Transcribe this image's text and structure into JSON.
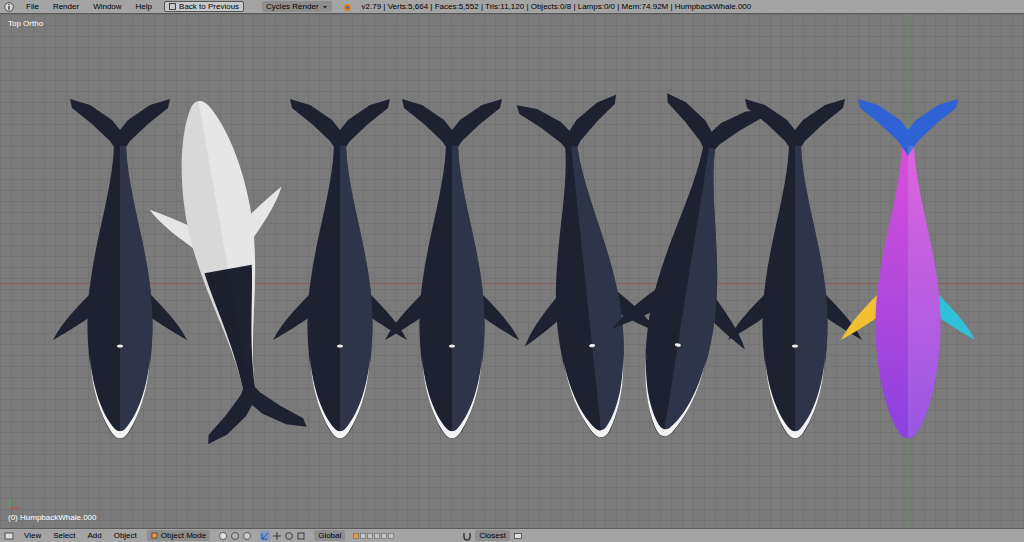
{
  "header": {
    "menus": [
      "File",
      "Render",
      "Window",
      "Help"
    ],
    "back_button": "Back to Previous",
    "engine": "Cycles Render",
    "stats": "v2.79 | Verts:5,664 | Faces:5,552 | Tris:11,120 | Objects:0/8 | Lamps:0/0 | Mem:74.92M | HumpbackWhale.000"
  },
  "viewport": {
    "view_name": "Top Ortho",
    "active_object": "(0) HumpbackWhale.000",
    "whales": [
      {
        "kind": "dark",
        "color": "#1e2230"
      },
      {
        "kind": "belly",
        "color": "#e6e6e6"
      },
      {
        "kind": "dark",
        "color": "#1e2230"
      },
      {
        "kind": "dark",
        "color": "#1e2230"
      },
      {
        "kind": "dark",
        "color": "#1e2230"
      },
      {
        "kind": "dark",
        "color": "#1e2230"
      },
      {
        "kind": "dark",
        "color": "#1e2230"
      },
      {
        "kind": "uv",
        "color": "#d94fd9"
      }
    ]
  },
  "footer": {
    "menus": [
      "View",
      "Select",
      "Add",
      "Object"
    ],
    "mode": "Object Mode",
    "orientation": "Global",
    "snap": "Closest"
  }
}
